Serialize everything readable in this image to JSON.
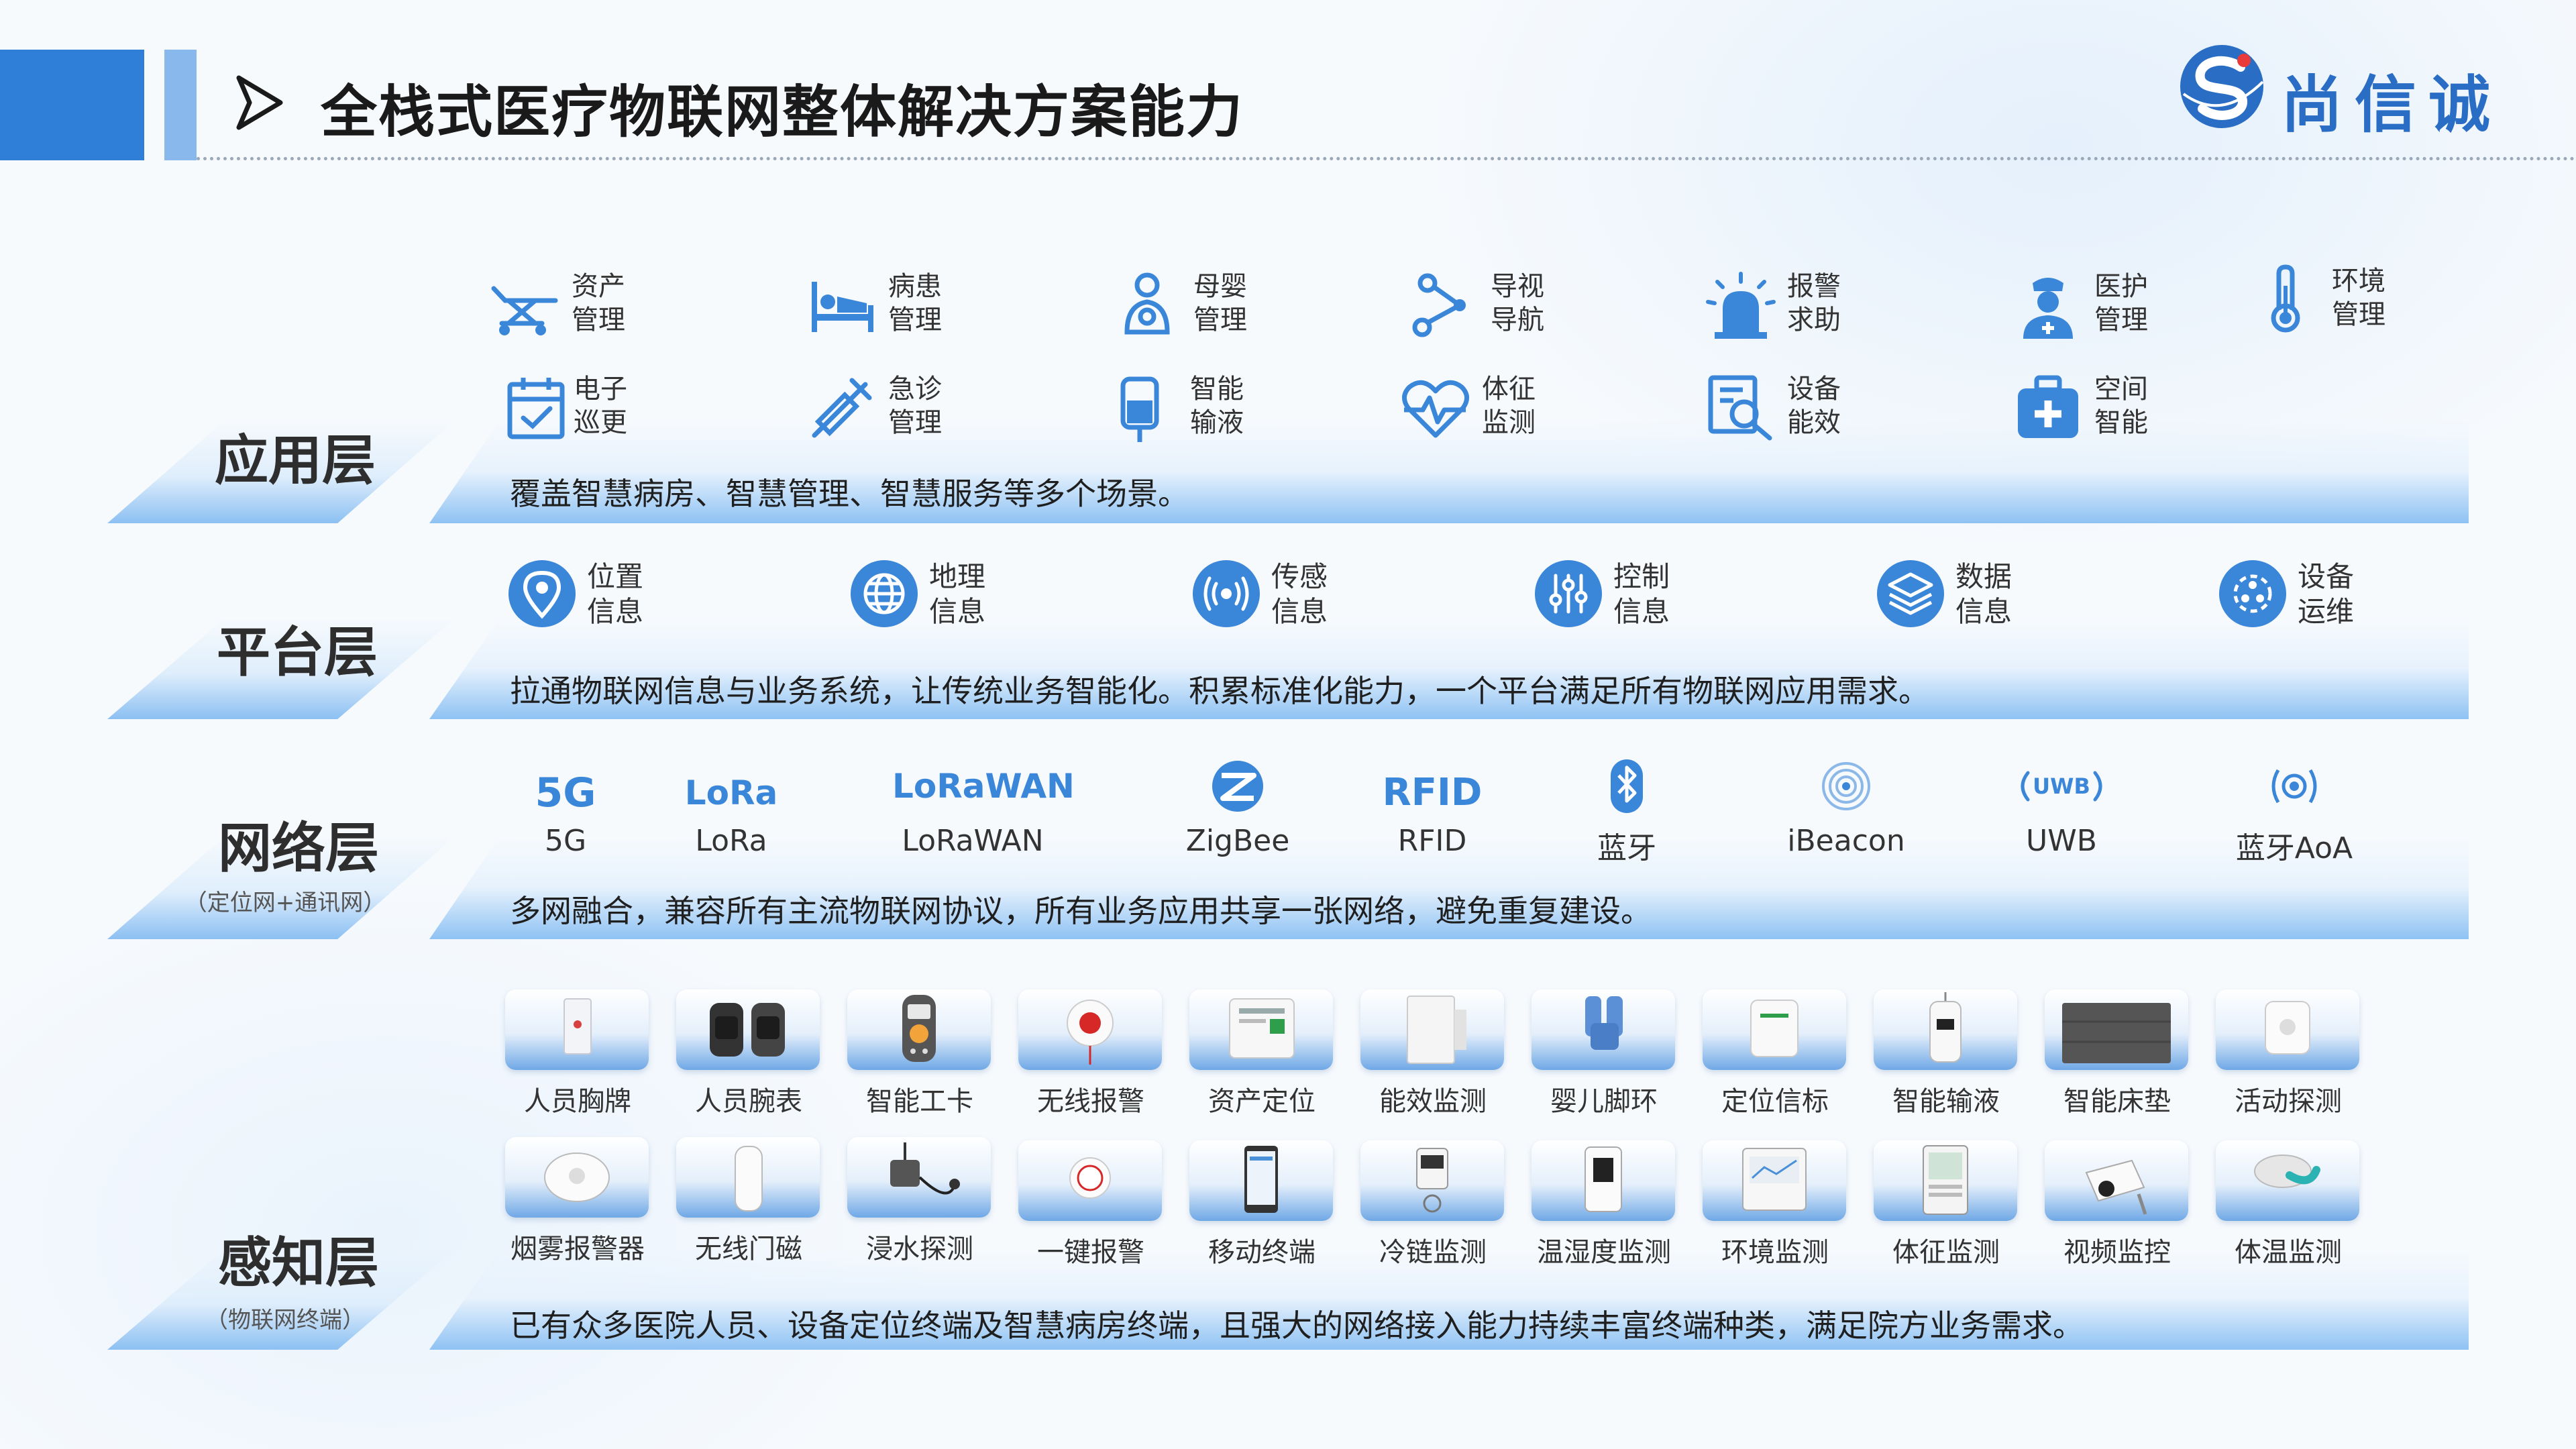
{
  "header": {
    "title": "全栈式医疗物联网整体解决方案能力",
    "logo_text": "尚信诚"
  },
  "colors": {
    "primary": "#2f7fd8",
    "secondary": "#88b8ec",
    "icon_blue": "#3a86d9",
    "band_blue": "#8ec2f3"
  },
  "layers": {
    "application": {
      "title": "应用层",
      "desc": "覆盖智慧病房、智慧管理、智慧服务等多个场景。",
      "items": [
        {
          "l1": "资产",
          "l2": "管理",
          "icon": "stretcher-icon"
        },
        {
          "l1": "病患",
          "l2": "管理",
          "icon": "hospital-bed-icon"
        },
        {
          "l1": "母婴",
          "l2": "管理",
          "icon": "mother-baby-icon"
        },
        {
          "l1": "导视",
          "l2": "导航",
          "icon": "route-icon"
        },
        {
          "l1": "报警",
          "l2": "求助",
          "icon": "alarm-siren-icon"
        },
        {
          "l1": "医护",
          "l2": "管理",
          "icon": "nurse-icon"
        },
        {
          "l1": "环境",
          "l2": "管理",
          "icon": "thermometer-icon"
        },
        {
          "l1": "电子",
          "l2": "巡更",
          "icon": "calendar-check-icon"
        },
        {
          "l1": "急诊",
          "l2": "管理",
          "icon": "syringe-icon"
        },
        {
          "l1": "智能",
          "l2": "输液",
          "icon": "iv-bag-icon"
        },
        {
          "l1": "体征",
          "l2": "监测",
          "icon": "heartbeat-icon"
        },
        {
          "l1": "设备",
          "l2": "能效",
          "icon": "device-search-icon"
        },
        {
          "l1": "空间",
          "l2": "智能",
          "icon": "medical-kit-icon"
        }
      ]
    },
    "platform": {
      "title": "平台层",
      "desc": "拉通物联网信息与业务系统，让传统业务智能化。积累标准化能力，一个平台满足所有物联网应用需求。",
      "items": [
        {
          "l1": "位置",
          "l2": "信息",
          "icon": "location-pin-icon"
        },
        {
          "l1": "地理",
          "l2": "信息",
          "icon": "globe-icon"
        },
        {
          "l1": "传感",
          "l2": "信息",
          "icon": "sensor-wave-icon"
        },
        {
          "l1": "控制",
          "l2": "信息",
          "icon": "sliders-icon"
        },
        {
          "l1": "数据",
          "l2": "信息",
          "icon": "layers-icon"
        },
        {
          "l1": "设备",
          "l2": "运维",
          "icon": "device-ops-icon"
        }
      ]
    },
    "network": {
      "title": "网络层",
      "subtitle": "（定位网+通讯网）",
      "desc": "多网融合，兼容所有主流物联网协议，所有业务应用共享一张网络，避免重复建设。",
      "items": [
        {
          "logo": "5G",
          "label": "5G",
          "icon": "5g-logo"
        },
        {
          "logo": "LoRa",
          "label": "LoRa",
          "icon": "lora-logo"
        },
        {
          "logo": "LoRaWAN",
          "label": "LoRaWAN",
          "icon": "lorawan-logo"
        },
        {
          "logo": "",
          "label": "ZigBee",
          "icon": "zigbee-icon"
        },
        {
          "logo": "RFID",
          "label": "RFID",
          "icon": "rfid-logo"
        },
        {
          "logo": "",
          "label": "蓝牙",
          "icon": "bluetooth-icon"
        },
        {
          "logo": "",
          "label": "iBeacon",
          "icon": "ibeacon-icon"
        },
        {
          "logo": "UWB",
          "label": "UWB",
          "icon": "uwb-icon"
        },
        {
          "logo": "",
          "label": "蓝牙AoA",
          "icon": "bluetooth-aoa-icon"
        }
      ]
    },
    "perception": {
      "title": "感知层",
      "subtitle": "（物联网终端）",
      "desc": "已有众多医院人员、设备定位终端及智慧病房终端，且强大的网络接入能力持续丰富终端种类，满足院方业务需求。",
      "row1": [
        "人员胸牌",
        "人员腕表",
        "智能工卡",
        "无线报警",
        "资产定位",
        "能效监测",
        "婴儿脚环",
        "定位信标",
        "智能输液",
        "智能床垫",
        "活动探测"
      ],
      "row2": [
        "烟雾报警器",
        "无线门磁",
        "浸水探测",
        "一键报警",
        "移动终端",
        "冷链监测",
        "温湿度监测",
        "环境监测",
        "体征监测",
        "视频监控",
        "体温监测"
      ]
    }
  }
}
